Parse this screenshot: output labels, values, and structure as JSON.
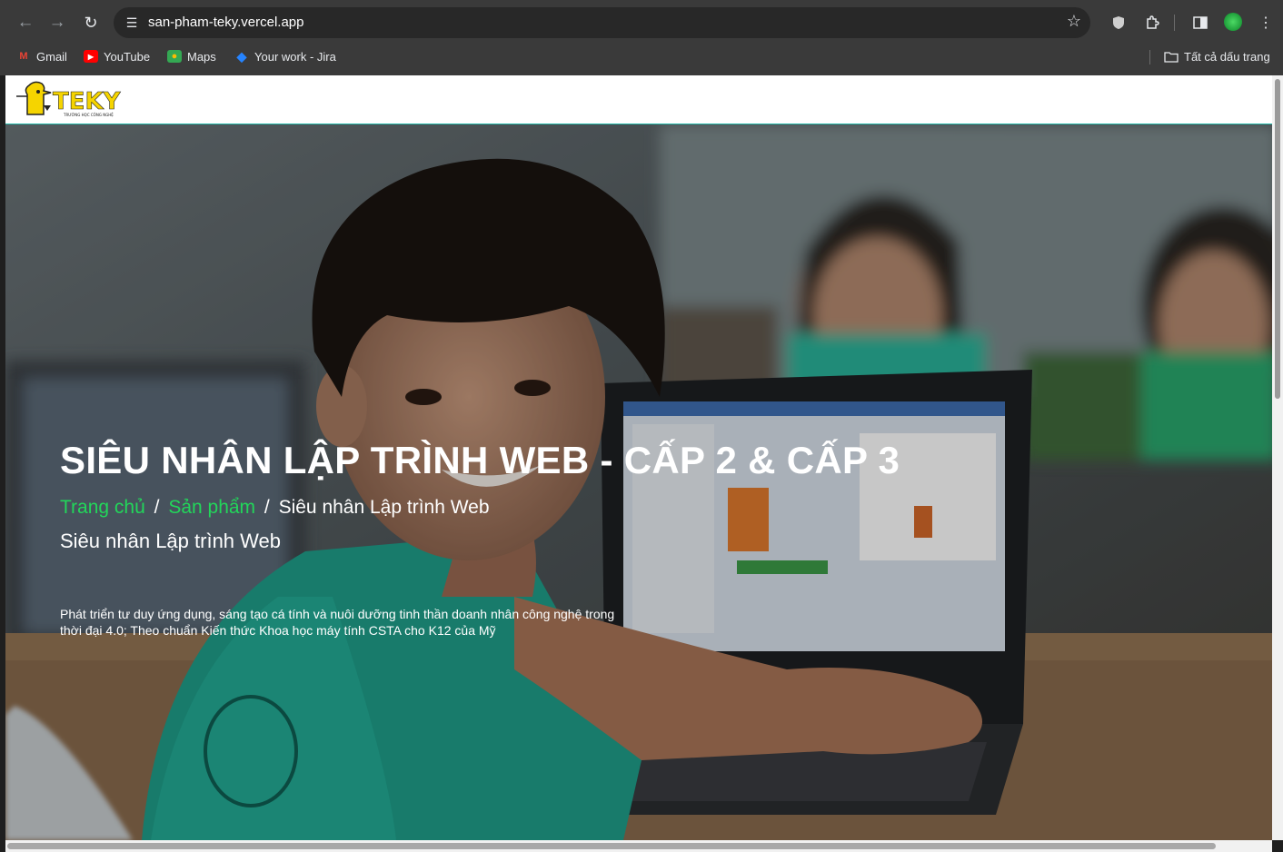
{
  "browser": {
    "url": "san-pham-teky.vercel.app",
    "bookmarks": [
      {
        "label": "Gmail",
        "icon": "gmail-icon"
      },
      {
        "label": "YouTube",
        "icon": "youtube-icon"
      },
      {
        "label": "Maps",
        "icon": "maps-icon"
      },
      {
        "label": "Your work - Jira",
        "icon": "jira-icon"
      }
    ],
    "all_bookmarks": "Tất cả dấu trang"
  },
  "site": {
    "logo_text": "TEKY",
    "logo_tagline": "TRƯỜNG HỌC CÔNG NGHỆ"
  },
  "hero": {
    "title": "SIÊU NHÂN LẬP TRÌNH WEB - CẤP 2 & CẤP 3",
    "breadcrumb": {
      "home": "Trang chủ",
      "products": "Sản phẩm",
      "current": "Siêu nhân Lập trình Web",
      "separator": "/"
    },
    "subtitle": "Siêu nhân Lập trình Web",
    "description_line1": "Phát triển tư duy ứng dụng, sáng tạo cá tính và nuôi dưỡng tinh thần doanh nhân công nghệ trong",
    "description_line2": "thời đại 4.0; Theo chuẩn Kiến thức Khoa học máy tính CSTA cho K12 của Mỹ"
  },
  "colors": {
    "accent_green": "#22d65a",
    "teal": "#1fb5a6",
    "logo_yellow": "#f5d400"
  }
}
